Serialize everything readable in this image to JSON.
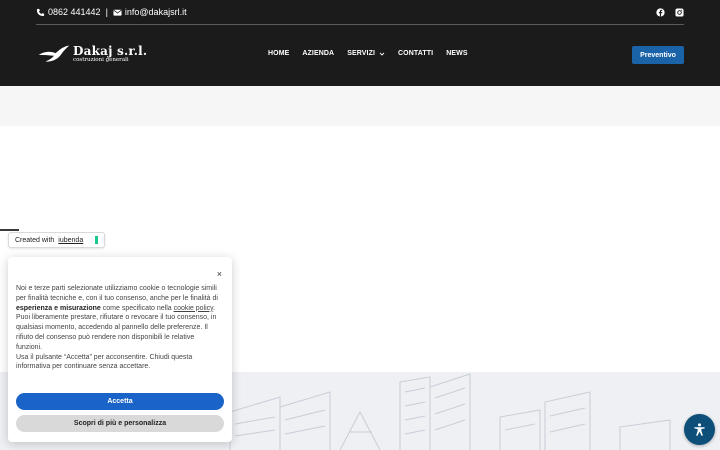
{
  "topbar": {
    "phone": "0862 441442",
    "separator": "|",
    "email": "info@dakajsrl.it",
    "phone_icon": "phone-icon",
    "email_icon": "envelope-icon",
    "socials": [
      "facebook-icon",
      "instagram-icon"
    ]
  },
  "logo": {
    "name": "Dakaj s.r.l.",
    "subtitle": "costruzioni generali"
  },
  "nav": {
    "items": [
      "HOME",
      "AZIENDA",
      "SERVIZI",
      "CONTATTI",
      "NEWS"
    ],
    "dropdown_icon": "chevron-down-icon"
  },
  "cta": {
    "label": "Preventivo"
  },
  "iubenda_badge": {
    "prefix": "Created with",
    "link": "iubenda"
  },
  "cookie_banner": {
    "close_glyph": "×",
    "text_1": "Noi e terze parti selezionate utilizziamo cookie o tecnologie simili per finalità tecniche e, con il tuo consenso, anche per le finalità di ",
    "text_bold": "esperienza e misurazione",
    "text_2": " come specificato nella ",
    "text_link": "cookie policy",
    "text_3": ". Puoi liberamente prestare, rifiutare o revocare il tuo consenso, in qualsiasi momento, accedendo al pannello delle preferenze. Il rifiuto del consenso può rendere non disponibili le relative funzioni.",
    "text_4": "Usa il pulsante “Accetta” per acconsentire. Chiudi questa informativa per continuare senza accettare.",
    "accept_label": "Accetta",
    "more_label": "Scopri di più e personalizza"
  },
  "accessibility": {
    "icon": "accessibility-icon"
  },
  "colors": {
    "header_bg": "#1b1b1b",
    "accent": "#1a63a8",
    "accept": "#1a63c8",
    "accessibility_bg": "#0e4f7a",
    "iubenda_green": "#1cc691"
  }
}
